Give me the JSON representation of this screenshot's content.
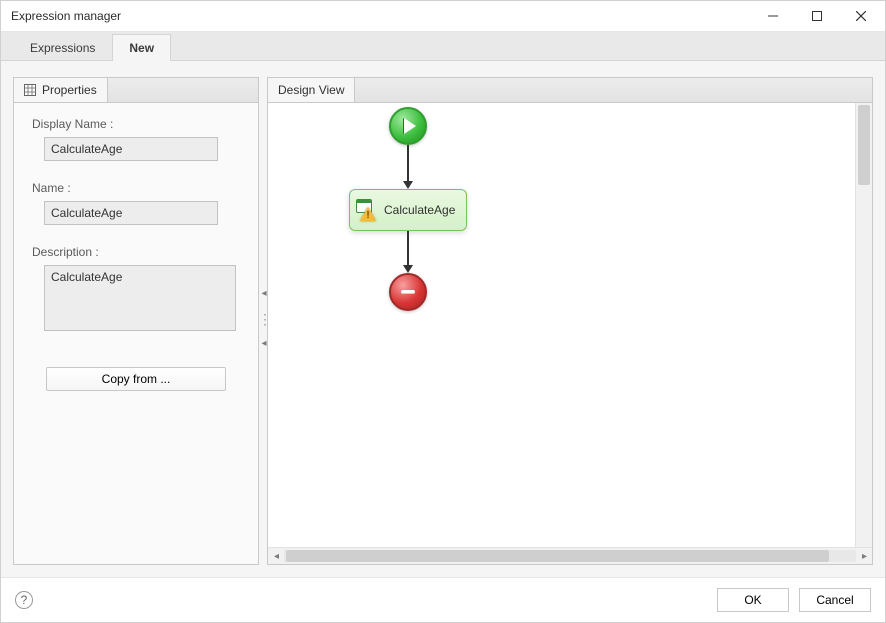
{
  "window": {
    "title": "Expression manager"
  },
  "tabs": [
    {
      "label": "Expressions",
      "active": false
    },
    {
      "label": "New",
      "active": true
    }
  ],
  "left_panel": {
    "tab_title": "Properties",
    "display_name_label": "Display Name :",
    "display_name_value": "CalculateAge",
    "name_label": "Name :",
    "name_value": "CalculateAge",
    "description_label": "Description :",
    "description_value": "CalculateAge",
    "copy_from_label": "Copy from ..."
  },
  "right_panel": {
    "tab_title": "Design View",
    "calc_node_label": "CalculateAge"
  },
  "footer": {
    "ok_label": "OK",
    "cancel_label": "Cancel"
  }
}
